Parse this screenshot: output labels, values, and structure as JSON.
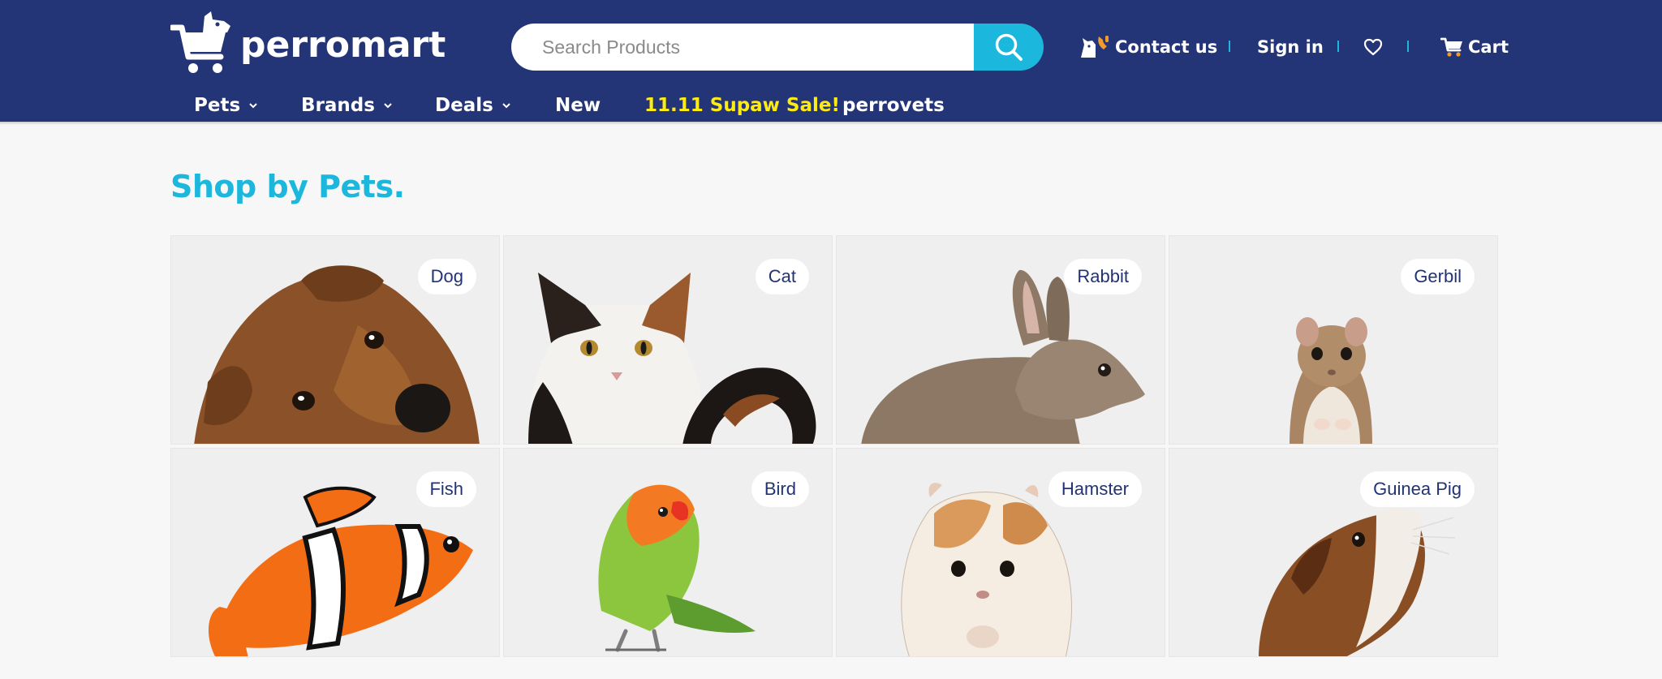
{
  "brand": {
    "name": "perromart"
  },
  "search": {
    "placeholder": "Search Products"
  },
  "utility": {
    "contact_label": "Contact us",
    "signin_label": "Sign in",
    "cart_label": "Cart"
  },
  "nav": {
    "items": [
      {
        "label": "Pets",
        "has_dropdown": true
      },
      {
        "label": "Brands",
        "has_dropdown": true
      },
      {
        "label": "Deals",
        "has_dropdown": true
      },
      {
        "label": "New",
        "has_dropdown": false
      },
      {
        "label": "11.11 Supaw Sale!",
        "has_dropdown": false
      },
      {
        "label": "perrovets",
        "has_dropdown": false
      }
    ]
  },
  "section": {
    "title": "Shop by Pets."
  },
  "pets": [
    {
      "label": "Dog"
    },
    {
      "label": "Cat"
    },
    {
      "label": "Rabbit"
    },
    {
      "label": "Gerbil"
    },
    {
      "label": "Fish"
    },
    {
      "label": "Bird"
    },
    {
      "label": "Hamster"
    },
    {
      "label": "Guinea Pig"
    }
  ],
  "colors": {
    "header_bg": "#233577",
    "accent": "#1cb7dd",
    "sale": "#ffeb14",
    "badge_text": "#223374",
    "page_bg": "#f7f7f7"
  },
  "icons": {
    "search": "search-icon",
    "contact": "dog-phone-icon",
    "wishlist": "heart-icon",
    "cart": "cart-icon",
    "dropdown": "chevron-down-icon"
  }
}
